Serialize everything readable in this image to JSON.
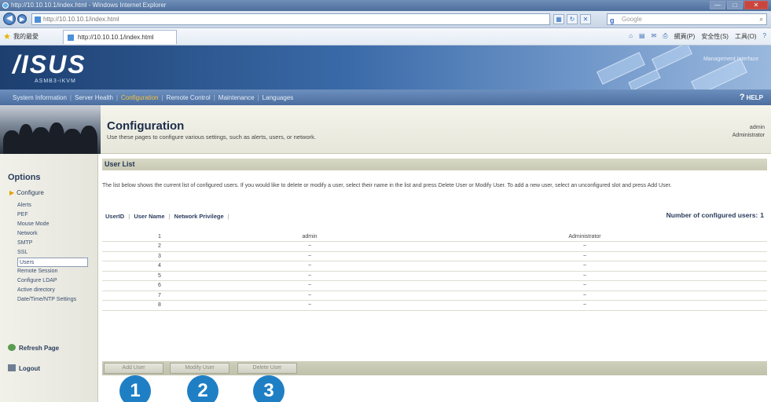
{
  "browser": {
    "window_title": "http://10.10.10.1/index.html - Windows Internet Explorer",
    "url": "http://10.10.10.1/index.html",
    "search_placeholder": "Google",
    "favorites_label": "我的最愛",
    "tab_title": "http://10.10.10.1/index.html",
    "cmd": [
      "網頁(P)",
      "安全性(S)",
      "工具(O)"
    ],
    "minimize_glyph": "—",
    "maximize_glyph": "□",
    "close_glyph": "✕"
  },
  "header": {
    "logo": "/ISUS",
    "sub": "ASMB3-iKVM",
    "right_text": "Management Interface"
  },
  "nav": {
    "items": [
      "System Information",
      "Server Health",
      "Configuration",
      "Remote Control",
      "Maintenance",
      "Languages"
    ],
    "active_index": 2,
    "help_glyph": "?",
    "help": "HELP"
  },
  "page": {
    "title": "Configuration",
    "description": "Use these pages to configure various settings, such as alerts, users, or network.",
    "user": "admin",
    "role": "Administrator"
  },
  "sidebar": {
    "title": "Options",
    "configure": "Configure",
    "items": [
      "Alerts",
      "PEF",
      "Mouse Mode",
      "Network",
      "SMTP",
      "SSL",
      "Users",
      "Remote Session",
      "Configure LDAP",
      "Active directory",
      "Date/Time/NTP Settings"
    ],
    "active_index": 6,
    "refresh": "Refresh Page",
    "logout": "Logout"
  },
  "content": {
    "section_title": "User List",
    "intro": "The list below shows the current list of configured users. If you would like to delete or modify a user, select their name in the list and press Delete User or Modify User. To add a new user, select an unconfigured slot and press Add User.",
    "col_headers": [
      "UserID",
      "User Name",
      "Network Privilege"
    ],
    "count_label": "Number of configured users:",
    "count_value": "1",
    "rows": [
      {
        "id": "1",
        "name": "admin",
        "priv": "Administrator"
      },
      {
        "id": "2",
        "name": "~",
        "priv": "~"
      },
      {
        "id": "3",
        "name": "~",
        "priv": "~"
      },
      {
        "id": "4",
        "name": "~",
        "priv": "~"
      },
      {
        "id": "5",
        "name": "~",
        "priv": "~"
      },
      {
        "id": "6",
        "name": "~",
        "priv": "~"
      },
      {
        "id": "7",
        "name": "~",
        "priv": "~"
      },
      {
        "id": "8",
        "name": "~",
        "priv": "~"
      }
    ],
    "buttons": [
      "Add User",
      "Modify User",
      "Delete User"
    ]
  },
  "callouts": [
    "1",
    "2",
    "3"
  ]
}
